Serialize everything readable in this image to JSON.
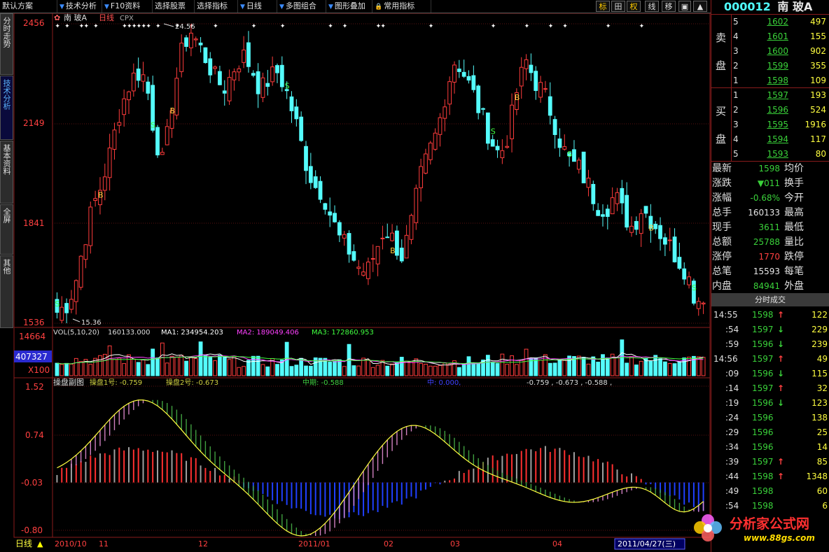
{
  "menu": {
    "items": [
      "默认方案",
      "技术分析",
      "F10资料",
      "选择股票",
      "选择指标",
      "日线",
      "多图组合",
      "图形叠加",
      "常用指标"
    ],
    "tools": [
      "标",
      "田",
      "权",
      "线",
      "移"
    ]
  },
  "left_tabs": [
    {
      "label": "分时走势",
      "active": false
    },
    {
      "label": "技术分析",
      "active": true
    },
    {
      "label": "基本资料",
      "active": false
    },
    {
      "label": "全屏",
      "active": false
    },
    {
      "label": "其他",
      "active": false
    }
  ],
  "main_chart": {
    "header_icon": "✿",
    "header_name": "南  玻A",
    "header_period": "日线",
    "header_type": "CPX",
    "price_ticks": [
      "2456",
      "2149",
      "1841",
      "1536"
    ],
    "high_label": "24.56",
    "low_label": "15.36"
  },
  "volume": {
    "header": "VOL(5,10,20)",
    "value": "160133.000",
    "ma1_label": "MA1: 234954.203",
    "ma2_label": "MA2: 189049.406",
    "ma3_label": "MA3: 172860.953",
    "ticks": [
      "14664",
      "407327",
      "X100"
    ]
  },
  "sub_chart": {
    "header": "操盘副图",
    "l1_label": "操盘1号: -0.759",
    "l2_label": "操盘2号: -0.673",
    "mid_label": "中期: -0.588",
    "zhong_label": "中: 0.000,",
    "extra": "-0.759 , -0.673 , -0.588 ,",
    "ticks": [
      "1.52",
      "0.74",
      "-0.03",
      "-0.80"
    ]
  },
  "date_axis": {
    "mode_label": "日线",
    "labels": [
      "2010/10",
      "11",
      "12",
      "2011/01",
      "02",
      "03",
      "04"
    ],
    "current_date": "2011/04/27(三)"
  },
  "quote": {
    "code": "000012",
    "name": "南  玻A",
    "sell_label": [
      "卖",
      "盘"
    ],
    "buy_label": [
      "买",
      "盘"
    ],
    "sells": [
      {
        "level": "5",
        "price": "1602",
        "vol": "497"
      },
      {
        "level": "4",
        "price": "1601",
        "vol": "155"
      },
      {
        "level": "3",
        "price": "1600",
        "vol": "902"
      },
      {
        "level": "2",
        "price": "1599",
        "vol": "355"
      },
      {
        "level": "1",
        "price": "1598",
        "vol": "109"
      }
    ],
    "buys": [
      {
        "level": "1",
        "price": "1597",
        "vol": "193"
      },
      {
        "level": "2",
        "price": "1596",
        "vol": "524"
      },
      {
        "level": "3",
        "price": "1595",
        "vol": "1916"
      },
      {
        "level": "4",
        "price": "1594",
        "vol": "117"
      },
      {
        "level": "5",
        "price": "1593",
        "vol": "80"
      }
    ],
    "stats": [
      {
        "k": "最新",
        "v": "1598",
        "v_color": "green",
        "k2": "均价",
        "v2": ""
      },
      {
        "k": "涨跌",
        "v": "▼011",
        "v_color": "green",
        "k2": "换手",
        "v2": ""
      },
      {
        "k": "涨幅",
        "v": "-0.68%",
        "v_color": "green",
        "k2": "今开",
        "v2": ""
      },
      {
        "k": "总手",
        "v": "160133",
        "v_color": "white",
        "k2": "最高",
        "v2": ""
      },
      {
        "k": "现手",
        "v": "3611",
        "v_color": "green",
        "k2": "最低",
        "v2": ""
      },
      {
        "k": "总额",
        "v": "25788",
        "v_color": "green",
        "k2": "量比",
        "v2": ""
      },
      {
        "k": "涨停",
        "v": "1770",
        "v_color": "red",
        "k2": "跌停",
        "v2": ""
      },
      {
        "k": "总笔",
        "v": "15593",
        "v_color": "white",
        "k2": "每笔",
        "v2": ""
      },
      {
        "k": "内盘",
        "v": "84941",
        "v_color": "green",
        "k2": "外盘",
        "v2": ""
      }
    ],
    "ticks_title": "分时成交",
    "trades": [
      {
        "time": "14:55",
        "price": "1598",
        "dir": "up",
        "vol": "122"
      },
      {
        "time": ":54",
        "price": "1597",
        "dir": "down",
        "vol": "229"
      },
      {
        "time": ":59",
        "price": "1596",
        "dir": "down",
        "vol": "239"
      },
      {
        "time": "14:56",
        "price": "1597",
        "dir": "up",
        "vol": "49"
      },
      {
        "time": ":09",
        "price": "1596",
        "dir": "down",
        "vol": "115"
      },
      {
        "time": ":14",
        "price": "1597",
        "dir": "up",
        "vol": "32"
      },
      {
        "time": ":19",
        "price": "1596",
        "dir": "down",
        "vol": "123"
      },
      {
        "time": ":24",
        "price": "1596",
        "dir": "",
        "vol": "138"
      },
      {
        "time": ":29",
        "price": "1596",
        "dir": "",
        "vol": "25"
      },
      {
        "time": ":34",
        "price": "1596",
        "dir": "",
        "vol": "14"
      },
      {
        "time": ":39",
        "price": "1597",
        "dir": "up",
        "vol": "85"
      },
      {
        "time": ":44",
        "price": "1598",
        "dir": "up",
        "vol": "1348"
      },
      {
        "time": ":49",
        "price": "1598",
        "dir": "",
        "vol": "60"
      },
      {
        "time": ":54",
        "price": "1598",
        "dir": "",
        "vol": "6"
      }
    ]
  },
  "watermark": {
    "title": "分析家公式网",
    "url": "www.88gs.com"
  },
  "chart_data": {
    "type": "candlestick",
    "title": "南  玻A 日线",
    "ylim": [
      15.36,
      24.56
    ],
    "x_labels": [
      "2010/10",
      "11",
      "12",
      "2011/01",
      "02",
      "03",
      "04"
    ],
    "close_path": [
      15.7,
      15.9,
      16.5,
      17.8,
      18.9,
      19.6,
      20.6,
      21.8,
      22.6,
      23.1,
      22.9,
      21.2,
      20.2,
      22.2,
      23.6,
      24.4,
      23.9,
      23.4,
      22.8,
      22.6,
      23.2,
      23.6,
      23.2,
      22.5,
      22.9,
      23.1,
      22.4,
      21.5,
      20.4,
      19.6,
      19.4,
      18.6,
      17.9,
      17.6,
      17.1,
      16.9,
      17.6,
      18.3,
      17.9,
      17.4,
      18.4,
      19.8,
      20.6,
      21.3,
      22.6,
      23.5,
      23.0,
      22.4,
      21.7,
      21.0,
      20.5,
      21.2,
      22.6,
      23.4,
      22.8,
      22.4,
      21.7,
      20.8,
      20.3,
      20.1,
      19.6,
      19.0,
      18.9,
      19.3,
      18.7,
      18.3,
      18.9,
      18.6,
      18.2,
      17.8,
      17.4,
      17.0,
      16.2,
      15.98
    ],
    "signals": [
      {
        "label": "S",
        "index": 0
      },
      {
        "label": "B",
        "index": 5
      },
      {
        "label": "S",
        "index": 11
      },
      {
        "label": "B",
        "index": 13
      },
      {
        "label": "S",
        "index": 26
      },
      {
        "label": "B",
        "index": 38
      },
      {
        "label": "S",
        "index": 49
      },
      {
        "label": "B",
        "index": 52
      },
      {
        "label": "S",
        "index": 58
      },
      {
        "label": "B",
        "index": 67
      },
      {
        "label": "S",
        "index": 72
      }
    ],
    "volume": {
      "ma1": 234954.203,
      "ma2": 189049.406,
      "ma3": 172860.953,
      "last": 160133.0,
      "ylim": [
        0,
        14664
      ]
    },
    "sub_indicator": {
      "ylim": [
        -0.8,
        1.52
      ],
      "op1": -0.759,
      "op2": -0.673,
      "mid": -0.588
    }
  }
}
